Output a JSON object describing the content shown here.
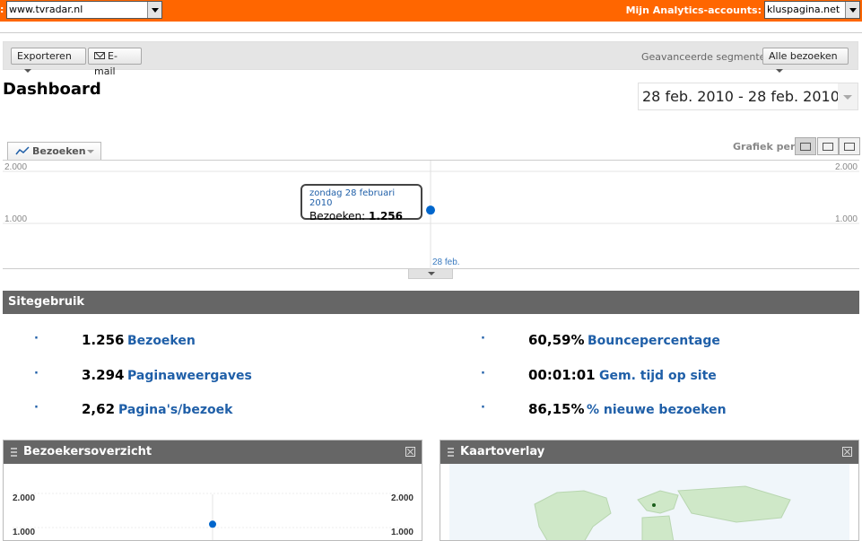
{
  "topbar": {
    "lead_text": ":",
    "site_value": "www.tvradar.nl",
    "accounts_label": "Mijn Analytics-accounts:",
    "account_value": "kluspagina.net"
  },
  "toolbar": {
    "export_label": "Exporteren",
    "email_label": "E-mail",
    "segments_label": "Geavanceerde segmenten:",
    "segments_value": "Alle bezoeken"
  },
  "page": {
    "title": "Dashboard",
    "date_range": "28 feb. 2010 - 28 feb. 2010"
  },
  "graph": {
    "metric_tab": "Bezoeken",
    "per_label": "Grafiek per:",
    "y_ticks": [
      "2.000",
      "1.000"
    ],
    "x_label": "28 feb.",
    "tooltip_date": "zondag 28 februari 2010",
    "tooltip_metric": "Bezoeken:",
    "tooltip_value": "1.256",
    "point_color": "#0066cc"
  },
  "sitegebruik": {
    "title": "Sitegebruik",
    "bullet": "·",
    "stats": [
      {
        "value": "1.256",
        "label": "Bezoeken"
      },
      {
        "value": "3.294",
        "label": "Paginaweergaves"
      },
      {
        "value": "2,62",
        "label": "Pagina's/bezoek"
      },
      {
        "value": "60,59%",
        "label": "Bouncepercentage"
      },
      {
        "value": "00:01:01",
        "label": "Gem. tijd op site"
      },
      {
        "value": "86,15%",
        "label": "% nieuwe bezoeken"
      }
    ]
  },
  "widgets": {
    "overview_title": "Bezoekersoverzicht",
    "overview_ticks": [
      "2.000",
      "1.000"
    ],
    "map_title": "Kaartoverlay"
  },
  "chart_data": {
    "type": "line",
    "x": [
      "28 feb."
    ],
    "series": [
      {
        "values": [
          1256
        ]
      }
    ],
    "ylim": [
      0,
      2000
    ]
  }
}
